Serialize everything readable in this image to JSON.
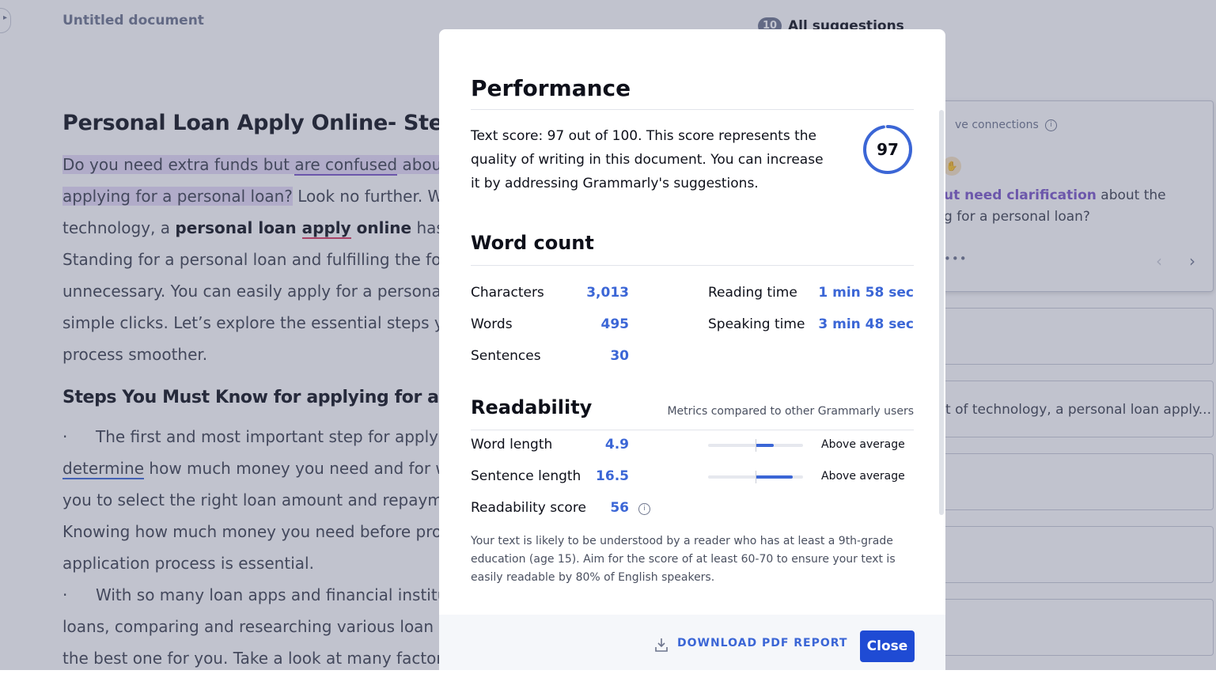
{
  "document": {
    "title": "Untitled document",
    "heading": "Personal Loan Apply Online- Steps",
    "paragraph1": [
      {
        "pre": "",
        "seg1": "Do you need extra funds but ",
        "under": "are confused",
        "post": " abou"
      },
      {
        "hl": "applying for a personal loan?",
        "rest": " Look no further. W"
      },
      {
        "pre": "technology, a ",
        "b1": "personal loan ",
        "bu": "apply",
        "b2": " online",
        "rest": " has b"
      },
      {
        "text": "Standing for a personal loan and fulfilling the fo"
      },
      {
        "text": "unnecessary. You can easily apply for a persona"
      },
      {
        "text": "simple clicks. Let’s explore the essential steps y"
      },
      {
        "text": "process smoother."
      }
    ],
    "subheading": "Steps You Must Know for applying for a per",
    "paragraph2": [
      {
        "bullet": "·",
        "text": "The first and most important step for applyi"
      },
      {
        "under": "determine",
        "rest": " how much money you need and for w"
      },
      {
        "text": "you to select the right loan amount and repaym"
      },
      {
        "text": "Knowing how much money you need before pro"
      },
      {
        "text": "application process is essential."
      },
      {
        "bullet": "·",
        "text": "With so many loan apps and financial institu"
      },
      {
        "text": "loans, comparing and researching various loan c"
      },
      {
        "text": "the best one for you. Take a look at many factor"
      }
    ]
  },
  "suggestions": {
    "count": "10",
    "label": "All suggestions",
    "card1": {
      "connections": "ve connections",
      "text_bold": "ut need clarification",
      "text_rest": " about the",
      "text_line2": "g for a personal loan?",
      "more": "•••"
    },
    "card_snippet": "t of technology, a personal loan apply..."
  },
  "modal": {
    "performance_title": "Performance",
    "performance_text": "Text score: 97 out of 100. This score represents the quality of writing in this document. You can increase it by addressing Grammarly's suggestions.",
    "score": "97",
    "score_fraction": 0.97,
    "word_count_title": "Word count",
    "stats": {
      "characters_label": "Characters",
      "characters_value": "3,013",
      "words_label": "Words",
      "words_value": "495",
      "sentences_label": "Sentences",
      "sentences_value": "30",
      "reading_label": "Reading time",
      "reading_value": "1 min 58 sec",
      "speaking_label": "Speaking time",
      "speaking_value": "3 min 48 sec"
    },
    "readability_title": "Readability",
    "metrics_note": "Metrics compared to other Grammarly users",
    "readability": {
      "word_length_label": "Word length",
      "word_length_value": "4.9",
      "word_length_status": "Above average",
      "sentence_length_label": "Sentence length",
      "sentence_length_value": "16.5",
      "sentence_length_status": "Above average",
      "score_label": "Readability score",
      "score_value": "56"
    },
    "readability_note": "Your text is likely to be understood by a reader who has at least a 9th-grade education (age 15). Aim for the score of at least 60-70 to ensure your text is easily readable by 80% of English speakers.",
    "download_label": "DOWNLOAD PDF REPORT",
    "close_label": "Close"
  },
  "colors": {
    "accent": "#3b66d6",
    "close_button": "#1f4bd4",
    "highlight": "#e6dbf7",
    "clarity": "#7b56c9"
  }
}
